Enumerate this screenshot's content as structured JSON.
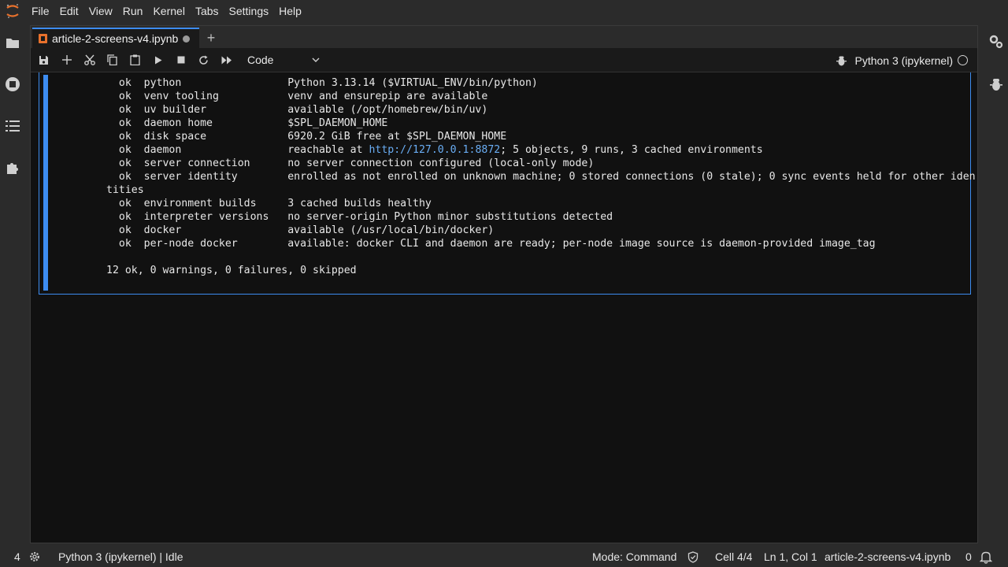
{
  "menubar": {
    "items": [
      "File",
      "Edit",
      "View",
      "Run",
      "Kernel",
      "Tabs",
      "Settings",
      "Help"
    ]
  },
  "tab": {
    "title": "article-2-screens-v4.ipynb"
  },
  "toolbar": {
    "cell_type": "Code",
    "kernel": "Python 3 (ipykernel)"
  },
  "output": {
    "lines": [
      [
        "  ok  python                 Python 3.13.14 ($VIRTUAL_ENV/bin/python)"
      ],
      [
        "  ok  venv tooling           venv and ensurepip are available"
      ],
      [
        "  ok  uv builder             available (/opt/homebrew/bin/uv)"
      ],
      [
        "  ok  daemon home            $SPL_DAEMON_HOME"
      ],
      [
        "  ok  disk space             6920.2 GiB free at $SPL_DAEMON_HOME"
      ],
      [
        "  ok  daemon                 reachable at ",
        "http://127.0.0.1:8872",
        "; 5 objects, 9 runs, 3 cached environments"
      ],
      [
        "  ok  server connection      no server connection configured (local-only mode)"
      ],
      [
        "  ok  server identity        enrolled as not enrolled on unknown machine; 0 stored connections (0 stale); 0 sync events held for other iden"
      ],
      [
        "tities"
      ],
      [
        "  ok  environment builds     3 cached builds healthy"
      ],
      [
        "  ok  interpreter versions   no server-origin Python minor substitutions detected"
      ],
      [
        "  ok  docker                 available (/usr/local/bin/docker)"
      ],
      [
        "  ok  per-node docker        available: docker CLI and daemon are ready; per-node image source is daemon-provided image_tag"
      ],
      [
        ""
      ],
      [
        "12 ok, 0 warnings, 0 failures, 0 skipped"
      ]
    ]
  },
  "statusbar": {
    "cell_count": "4",
    "kernel_status": "Python 3 (ipykernel) | Idle",
    "mode": "Mode: Command",
    "cell_position": "Cell 4/4",
    "cursor": "Ln 1, Col 1",
    "filename": "article-2-screens-v4.ipynb",
    "notifications": "0"
  }
}
